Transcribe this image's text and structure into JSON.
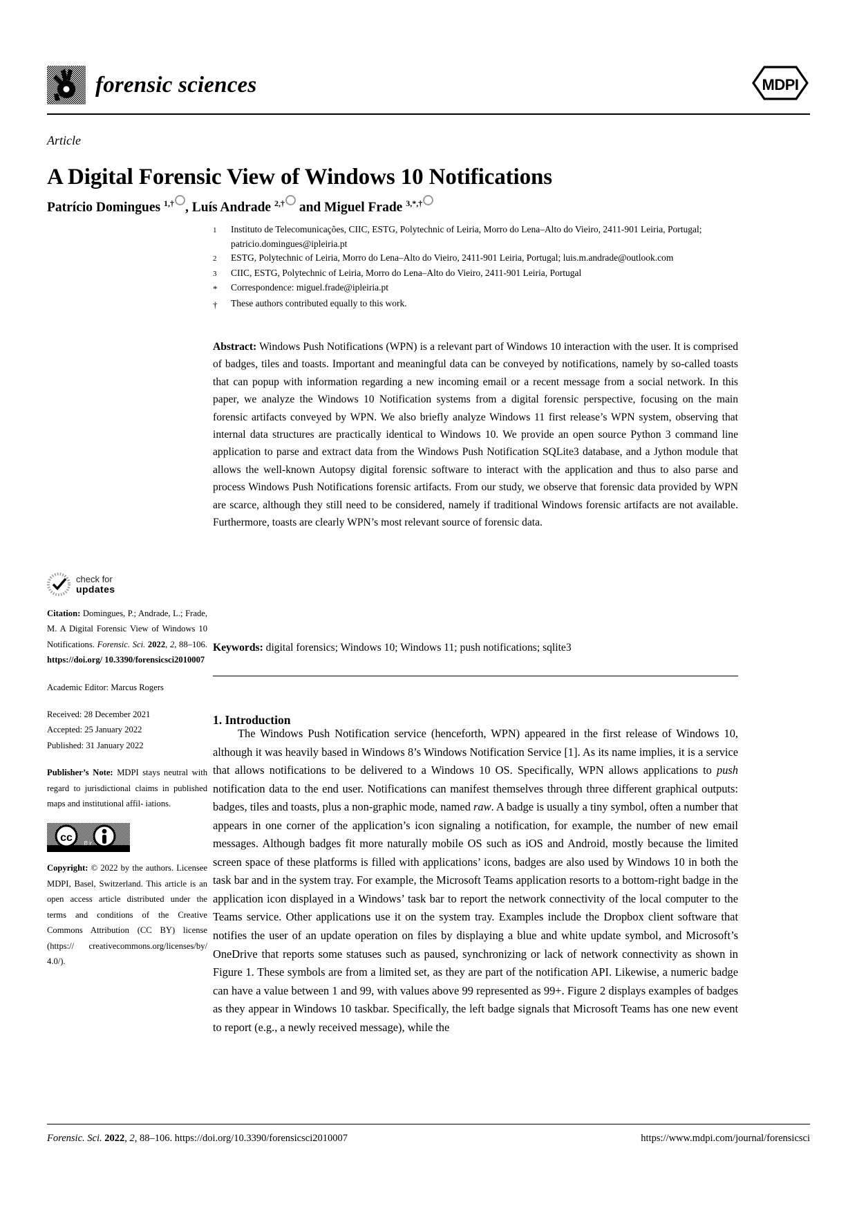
{
  "header": {
    "journal_name": "forensic sciences",
    "publisher_logo_text": "MDPI",
    "journal_logo_name": "handprint-logo"
  },
  "article": {
    "kind": "Article",
    "title": "A Digital Forensic View of Windows 10 Notifications",
    "authors_html": "Patrício Domingues <sup>1,†</sup><span class=\"orcid\"></span>, Luís Andrade <sup>2,†</sup><span class=\"orcid\"></span> and Miguel Frade <sup>3,*,†</sup><span class=\"orcid\"></span>"
  },
  "affiliations": [
    {
      "mark": "1",
      "text": "Instituto de Telecomunicações, CIIC, ESTG, Polytechnic of Leiria, Morro do Lena–Alto do Vieiro, 2411-901 Leiria, Portugal; patricio.domingues@ipleiria.pt"
    },
    {
      "mark": "2",
      "text": "ESTG, Polytechnic of Leiria, Morro do Lena–Alto do Vieiro, 2411-901 Leiria, Portugal; luis.m.andrade@outlook.com"
    },
    {
      "mark": "3",
      "text": "CIIC, ESTG, Polytechnic of Leiria, Morro do Lena–Alto do Vieiro, 2411-901 Leiria, Portugal"
    },
    {
      "mark": "*",
      "text": "Correspondence: miguel.frade@ipleiria.pt"
    },
    {
      "mark": "†",
      "text": "These authors contributed equally to this work."
    }
  ],
  "abstract": {
    "label": "Abstract:",
    "text": " Windows Push Notifications (WPN) is a relevant part of Windows 10 interaction with the user. It is comprised of badges, tiles and toasts. Important and meaningful data can be conveyed by notifications, namely by so-called toasts that can popup with information regarding a new incoming email or a recent message from a social network. In this paper, we analyze the Windows 10 Notification systems from a digital forensic perspective, focusing on the main forensic artifacts conveyed by WPN. We also briefly analyze Windows 11 first release’s WPN system, observing that internal data structures are practically identical to Windows 10. We provide an open source Python 3 command line application to parse and extract data from the Windows Push Notification SQLite3 database, and a Jython module that allows the well-known Autopsy digital forensic software to interact with the application and thus to also parse and process Windows Push Notifications forensic artifacts. From our study, we observe that forensic data provided by WPN are scarce, although they still need to be considered, namely if traditional Windows forensic artifacts are not available. Furthermore, toasts are clearly WPN’s most relevant source of forensic data."
  },
  "keywords": {
    "label": "Keywords:",
    "text": " digital forensics; Windows 10; Windows 11; push notifications; sqlite3"
  },
  "introduction": {
    "heading": "1. Introduction",
    "paragraph_html": "<span class=\"indent\"></span>The Windows Push Notification service (henceforth, WPN) appeared in the first release of Windows 10, although it was heavily based in Windows 8’s Windows Notification Service [1]. As its name implies, it is a service that allows notifications to be delivered to a Windows 10 OS. Specifically, WPN allows applications to <i>push</i> notification data to the end user. Notifications can manifest themselves through three different graphical outputs: badges, tiles and toasts, plus a non-graphic mode, named <i>raw</i>. A badge is usually a tiny symbol, often a number that appears in one corner of the application’s icon signaling a notification, for example, the number of new email messages. Although badges fit more naturally mobile OS such as iOS and Android, mostly because the limited screen space of these platforms is filled with applications’ icons, badges are also used by Windows 10 in both the task bar and in the system tray. For example, the Microsoft Teams application resorts to a bottom-right badge in the application icon displayed in a Windows’ task bar to report the network connectivity of the local computer to the Teams service. Other applications use it on the system tray. Examples include the Dropbox client software that notifies the user of an update operation on files by displaying a blue and white update symbol, and Microsoft’s OneDrive that reports some statuses such as paused, synchronizing or lack of network connectivity as shown in Figure 1. These symbols are from a limited set, as they are part of the notification API. Likewise, a numeric badge can have a value between 1 and 99, with values above 99 represented as 99+. Figure 2 displays examples of badges as they appear in Windows 10 taskbar. Specifically, the left badge signals that Microsoft Teams has one new event to report (e.g., a newly received message), while the"
  },
  "sidebar": {
    "check_updates": {
      "line1": "check for",
      "line2": "updates",
      "icon": "check-for-updates-icon"
    },
    "citation_html": "<b>Citation:</b> Domingues, P.; Andrade, L.; Frade, M. A Digital Forensic View of Windows 10 Notifications. <i>Forensic. Sci.</i> <b>2022</b>, <i>2</i>, 88–106. <b>https://doi.org/ 10.3390/forensicsci2010007</b>",
    "academic_editor": "Academic Editor: Marcus Rogers",
    "received": "Received: 28 December 2021",
    "accepted": "Accepted: 25 January 2022",
    "published": "Published: 31 January 2022",
    "publishers_note_html": "<b>Publisher’s Note:</b> MDPI stays neutral with regard to jurisdictional claims in published maps and institutional affil- iations.",
    "license_badge": "cc-by-license-badge",
    "copyright_html": "<b>Copyright:</b> © 2022 by the authors. Licensee MDPI, Basel, Switzerland. This article is an open access article distributed under the terms and conditions of the Creative Commons Attribution (CC BY) license (https:// creativecommons.org/licenses/by/ 4.0/)."
  },
  "footer": {
    "left_html": "<i>Forensic. Sci.</i> <b>2022</b>, <i>2</i>, 88–106. https://doi.org/10.3390/forensicsci2010007",
    "right": "https://www.mdpi.com/journal/forensicsci"
  }
}
